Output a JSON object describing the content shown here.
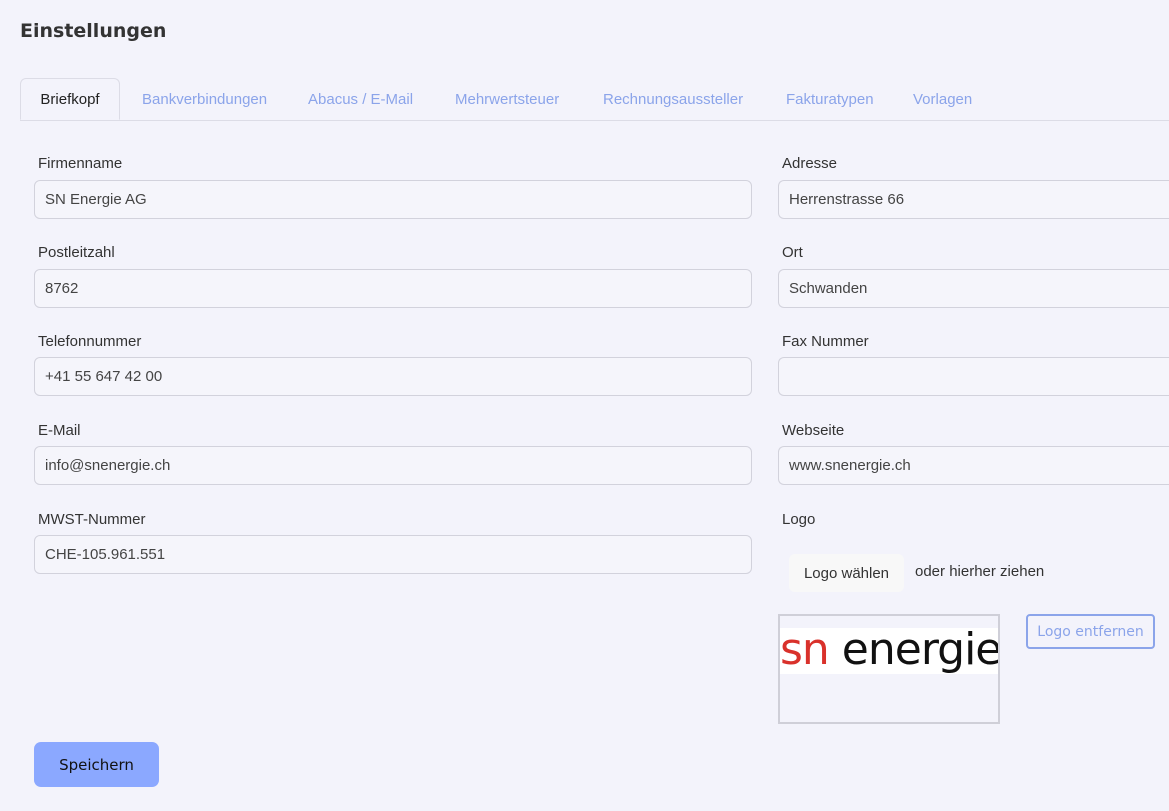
{
  "page": {
    "title": "Einstellungen"
  },
  "tabs": [
    {
      "label": "Briefkopf",
      "active": true
    },
    {
      "label": "Bankverbindungen",
      "active": false
    },
    {
      "label": "Abacus / E-Mail",
      "active": false
    },
    {
      "label": "Mehrwertsteuer",
      "active": false
    },
    {
      "label": "Rechnungsaussteller",
      "active": false
    },
    {
      "label": "Fakturatypen",
      "active": false
    },
    {
      "label": "Vorlagen",
      "active": false
    }
  ],
  "form": {
    "firmenname": {
      "label": "Firmenname",
      "value": "SN Energie AG"
    },
    "adresse": {
      "label": "Adresse",
      "value": "Herrenstrasse 66"
    },
    "postleitzahl": {
      "label": "Postleitzahl",
      "value": "8762"
    },
    "ort": {
      "label": "Ort",
      "value": "Schwanden"
    },
    "telefon": {
      "label": "Telefonnummer",
      "value": "+41 55 647 42 00"
    },
    "fax": {
      "label": "Fax Nummer",
      "value": ""
    },
    "email": {
      "label": "E-Mail",
      "value": "info@snenergie.ch"
    },
    "webseite": {
      "label": "Webseite",
      "value": "www.snenergie.ch"
    },
    "mwst": {
      "label": "MWST-Nummer",
      "value": "CHE-105.961.551"
    }
  },
  "logo": {
    "label": "Logo",
    "choose_label": "Logo wählen",
    "drop_hint": "oder hierher ziehen",
    "remove_label": "Logo entfernen",
    "preview_text_sn": "sn",
    "preview_text_energie": " energie",
    "brand_red": "#d9312b"
  },
  "actions": {
    "save_label": "Speichern"
  },
  "colors": {
    "accent": "#8ba4ea",
    "primary_button": "#8ba8ff",
    "background": "#f3f3fb"
  }
}
